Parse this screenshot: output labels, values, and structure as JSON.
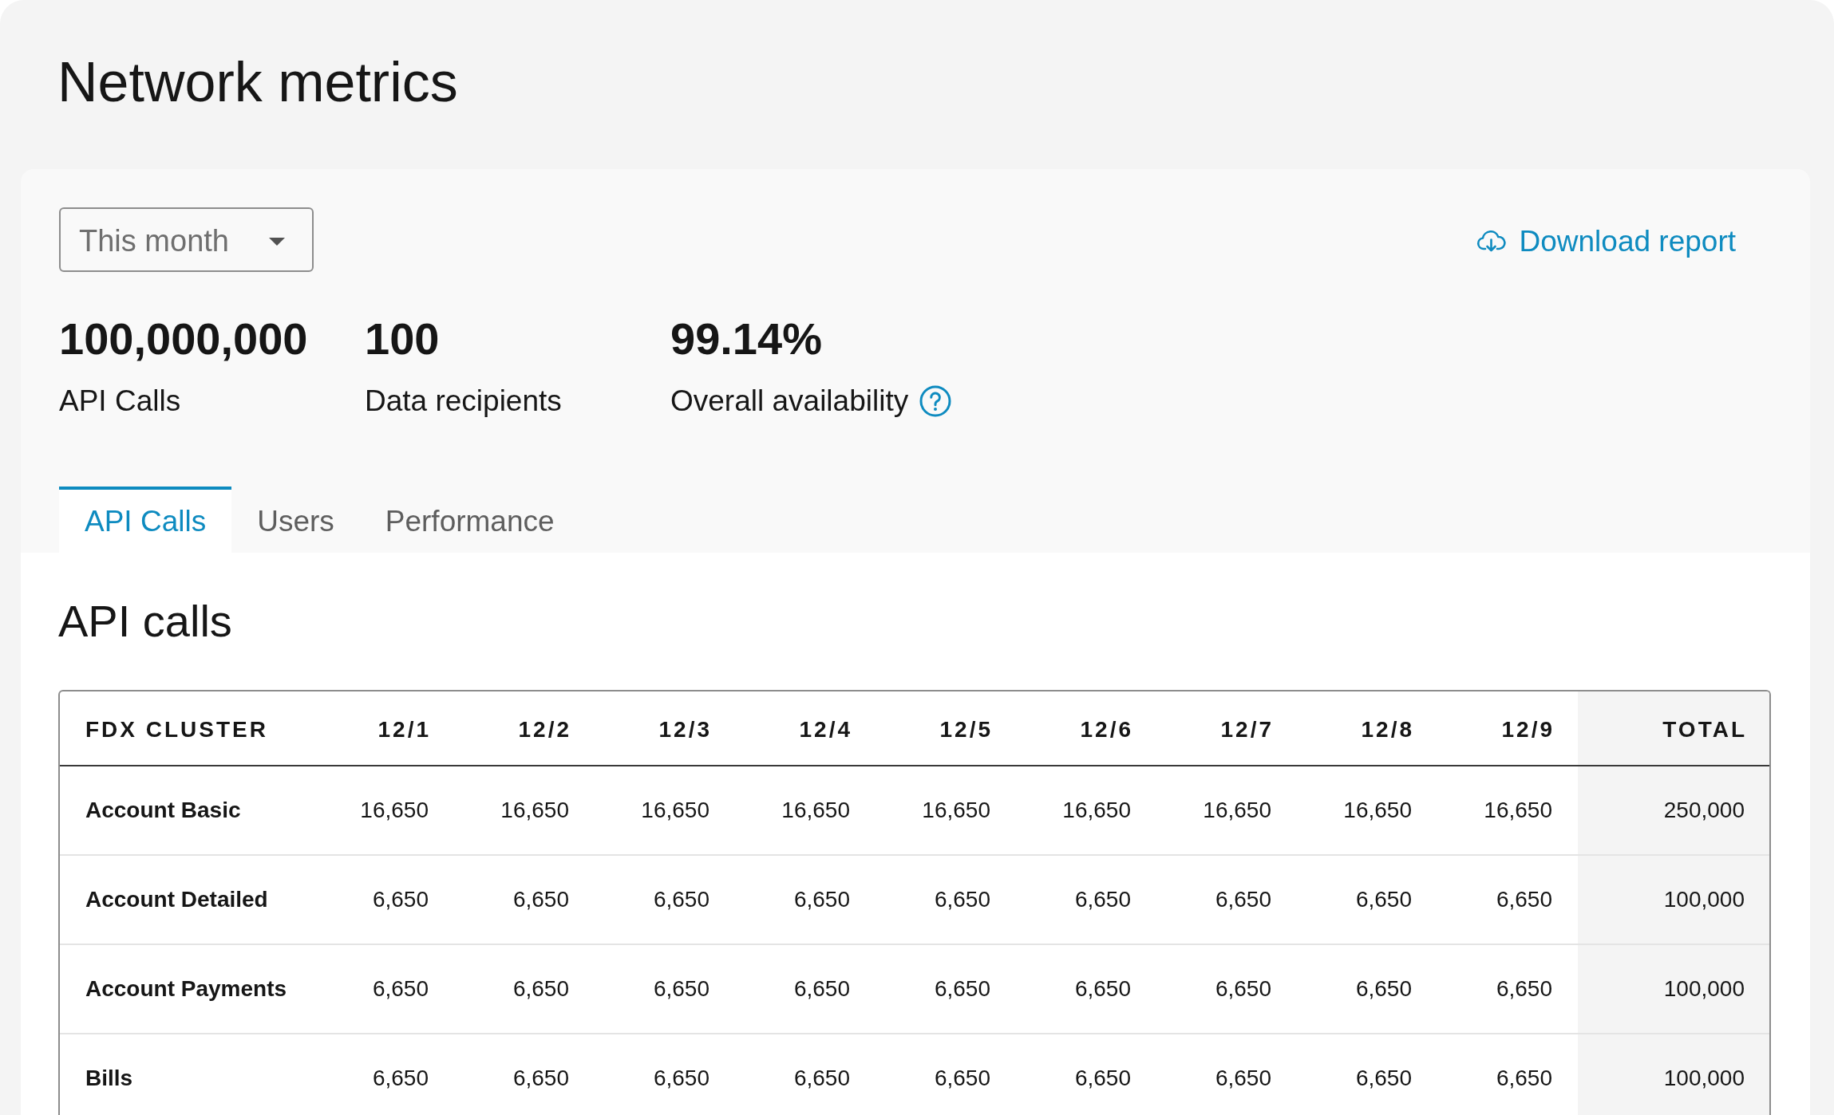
{
  "page": {
    "title": "Network metrics"
  },
  "period_filter": {
    "value": "This month"
  },
  "download_link": {
    "label": "Download report"
  },
  "metrics": [
    {
      "value": "100,000,000",
      "label": "API Calls"
    },
    {
      "value": "100",
      "label": "Data recipients"
    },
    {
      "value": "99.14%",
      "label": "Overall availability",
      "help_icon": true
    }
  ],
  "tabs": [
    {
      "label": "API Calls",
      "selected": true
    },
    {
      "label": "Users",
      "selected": false
    },
    {
      "label": "Performance",
      "selected": false
    }
  ],
  "api_calls": {
    "title": "API calls",
    "table": {
      "columns": [
        {
          "label": "FDX CLUSTER",
          "kind": "name"
        },
        {
          "label": "12/1",
          "kind": "day"
        },
        {
          "label": "12/2",
          "kind": "day"
        },
        {
          "label": "12/3",
          "kind": "day"
        },
        {
          "label": "12/4",
          "kind": "day"
        },
        {
          "label": "12/5",
          "kind": "day"
        },
        {
          "label": "12/6",
          "kind": "day"
        },
        {
          "label": "12/7",
          "kind": "day"
        },
        {
          "label": "12/8",
          "kind": "day"
        },
        {
          "label": "12/9",
          "kind": "day"
        },
        {
          "label": "TOTAL",
          "kind": "total"
        }
      ],
      "rows": [
        {
          "cells": [
            "Account Basic",
            "16,650",
            "16,650",
            "16,650",
            "16,650",
            "16,650",
            "16,650",
            "16,650",
            "16,650",
            "16,650",
            "250,000"
          ]
        },
        {
          "cells": [
            "Account Detailed",
            "6,650",
            "6,650",
            "6,650",
            "6,650",
            "6,650",
            "6,650",
            "6,650",
            "6,650",
            "6,650",
            "100,000"
          ]
        },
        {
          "cells": [
            "Account Payments",
            "6,650",
            "6,650",
            "6,650",
            "6,650",
            "6,650",
            "6,650",
            "6,650",
            "6,650",
            "6,650",
            "100,000"
          ]
        },
        {
          "cells": [
            "Bills",
            "6,650",
            "6,650",
            "6,650",
            "6,650",
            "6,650",
            "6,650",
            "6,650",
            "6,650",
            "6,650",
            "100,000"
          ]
        }
      ]
    }
  }
}
